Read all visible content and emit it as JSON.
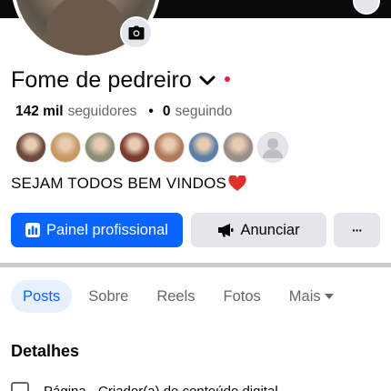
{
  "profile": {
    "name": "Fome de pedreiro",
    "followers_count": "142 mil",
    "followers_label": "seguidores",
    "following_count": "0",
    "following_label": "seguindo",
    "bio": "SEJAM TODOS BEM VINDOS",
    "bio_emoji": "red-heart-icon"
  },
  "friend_avatars": [
    {
      "color": "#6b4a3a"
    },
    {
      "color": "#c89a62"
    },
    {
      "color": "#8a8f76"
    },
    {
      "color": "#7b3b2e"
    },
    {
      "color": "#b07a5a"
    },
    {
      "color": "#5b7fa6"
    },
    {
      "color": "#9a8e86"
    },
    {
      "color": "#bcc0c4"
    }
  ],
  "actions": {
    "primary_label": "Painel profissional",
    "secondary_label": "Anunciar",
    "more_label": "···"
  },
  "tabs": [
    {
      "label": "Posts",
      "active": true
    },
    {
      "label": "Sobre"
    },
    {
      "label": "Reels"
    },
    {
      "label": "Fotos"
    },
    {
      "label": "Mais"
    }
  ],
  "details": {
    "title": "Detalhes",
    "first_item": "Página · Criador(a) de conteúdo digital"
  },
  "colors": {
    "accent": "#0866ff",
    "secondary_button": "#e4e6eb",
    "notification_dot": "#e41e3f",
    "muted_text": "#65676b"
  }
}
